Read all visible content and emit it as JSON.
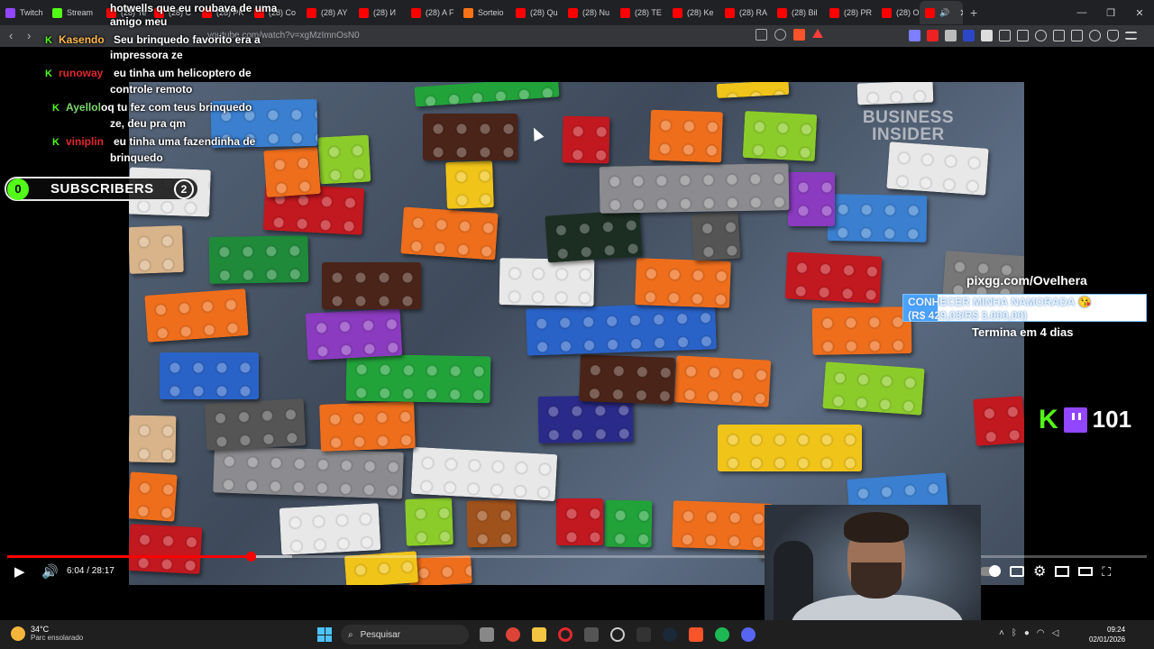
{
  "browser": {
    "tabs": [
      {
        "label": "Twitch",
        "color": "#9146ff"
      },
      {
        "label": "Stream",
        "color": "#53fc18"
      },
      {
        "label": "(28) Ye",
        "color": "#ff0000"
      },
      {
        "label": "(28) C",
        "color": "#ff0000"
      },
      {
        "label": "(28) PK",
        "color": "#ff0000"
      },
      {
        "label": "(28) Co",
        "color": "#ff0000"
      },
      {
        "label": "(28) AY",
        "color": "#ff0000"
      },
      {
        "label": "(28) И",
        "color": "#ff0000"
      },
      {
        "label": "(28) A F",
        "color": "#ff0000"
      },
      {
        "label": "Sorteio",
        "color": "#f97316"
      },
      {
        "label": "(28) Qu",
        "color": "#ff0000"
      },
      {
        "label": "(28) Nu",
        "color": "#ff0000"
      },
      {
        "label": "(28) TE",
        "color": "#ff0000"
      },
      {
        "label": "(28) Ke",
        "color": "#ff0000"
      },
      {
        "label": "(28) RA",
        "color": "#ff0000"
      },
      {
        "label": "(28) Bil",
        "color": "#ff0000"
      },
      {
        "label": "(28) PR",
        "color": "#ff0000"
      },
      {
        "label": "(28) Or",
        "color": "#ff0000"
      }
    ],
    "active_tab_color": "#ff0000",
    "url": "youtube.com/watch?v=xgMzImnOsN0"
  },
  "chat": [
    {
      "user": "",
      "user_color": "#ffffff",
      "text": "hotwells que eu roubava de uma",
      "top": "0"
    },
    {
      "user": "",
      "user_color": "#ffffff",
      "text": "amigo meu",
      "top": "1"
    },
    {
      "user": "Kasendo",
      "user_color": "#ffb84d",
      "text": "Seu brinquedo favorito era a",
      "top": "2"
    },
    {
      "user": "",
      "user_color": "#ffffff",
      "text": "impressora ze",
      "top": "3"
    },
    {
      "user": "runoway",
      "user_color": "#e0282e",
      "text": "eu tinha um helicoptero de",
      "top": "4"
    },
    {
      "user": "",
      "user_color": "#ffffff",
      "text": "controle remoto",
      "top": "5"
    },
    {
      "user": "Ayellol",
      "user_color": "#7bd96b",
      "text": "oq tu fez com teus brinquedo",
      "top": "6"
    },
    {
      "user": "",
      "user_color": "#ffffff",
      "text": "ze, deu pra qm",
      "top": "7"
    },
    {
      "user": "viniplin",
      "user_color": "#e0282e",
      "text": "eu tinha uma fazendinha de",
      "top": "8"
    },
    {
      "user": "",
      "user_color": "#ffffff",
      "text": "brinquedo",
      "top": "9"
    }
  ],
  "subscribers": {
    "left_count": "0",
    "label": "SUBSCRIBERS",
    "right_count": "2"
  },
  "donation": {
    "link": "pixgg.com/Ovelhera",
    "goal_title": "CONHECER MINHA NAMORADA 😘",
    "goal_amount": "(R$ 429,03/R$ 3.000,00)",
    "goal_progress": 0.143,
    "ends": "Termina em 4 dias"
  },
  "viewers": {
    "count": "101"
  },
  "video": {
    "watermark_line1": "BUSINESS",
    "watermark_line2": "INSIDER",
    "time": "6:04 / 28:17",
    "progress": 0.214,
    "buffered": 0.25
  },
  "taskbar": {
    "temp": "34°C",
    "weather": "Parc ensolarado",
    "search_placeholder": "Pesquisar",
    "time": "09:24",
    "date": "02/01/2026"
  }
}
